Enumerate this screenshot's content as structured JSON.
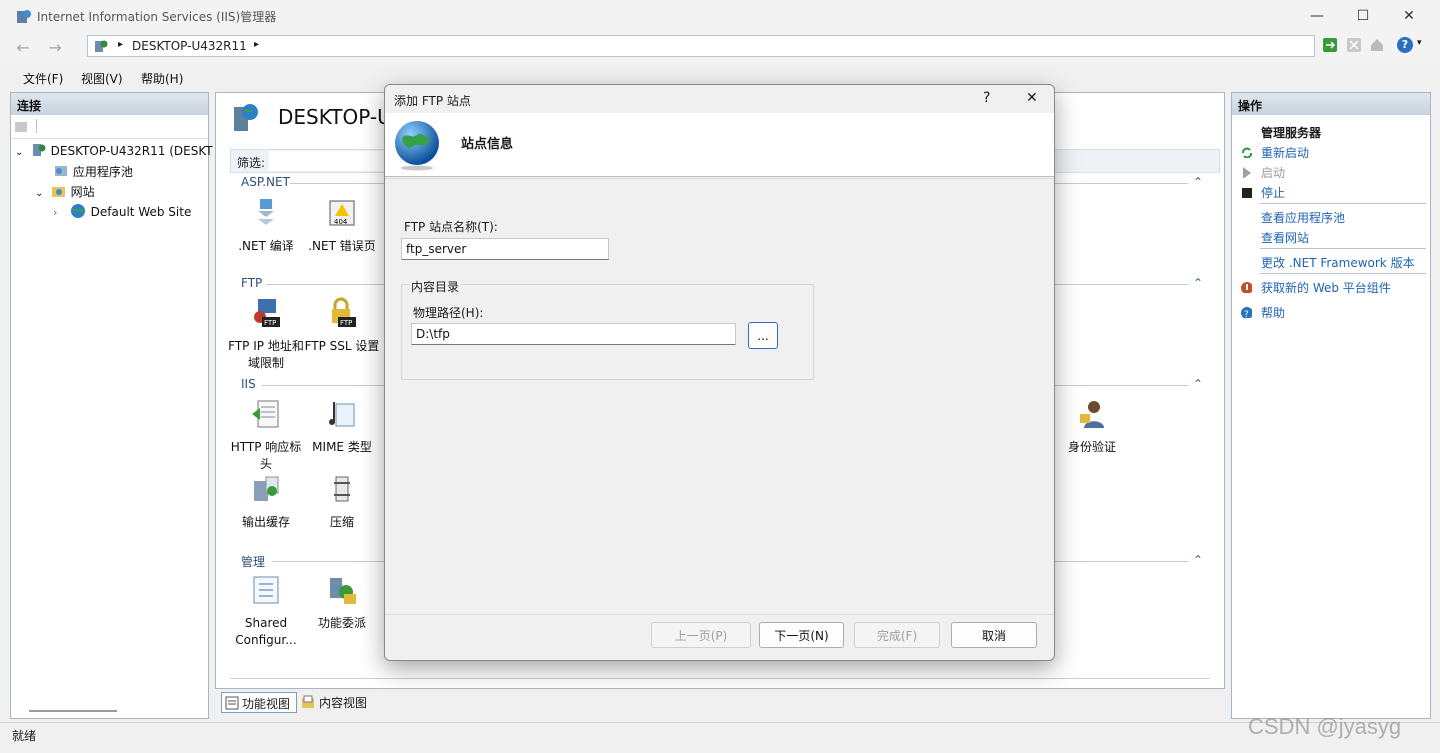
{
  "window": {
    "title": "Internet Information Services (IIS)管理器",
    "controls": {
      "minimize": "—",
      "maximize": "☐",
      "close": "✕"
    }
  },
  "address": {
    "crumb": "DESKTOP-U432R11",
    "sep": "▸",
    "back": "←",
    "forward": "→",
    "help": "?"
  },
  "menu": [
    "文件(F)",
    "视图(V)",
    "帮助(H)"
  ],
  "connections": {
    "title": "连接",
    "tree": [
      {
        "label": "DESKTOP-U432R11 (DESKT",
        "expander": "⌄"
      },
      {
        "label": "应用程序池",
        "expander": ""
      },
      {
        "label": "网站",
        "expander": "⌄"
      },
      {
        "label": "Default Web Site",
        "expander": "›"
      }
    ]
  },
  "center": {
    "title": "DESKTOP-U",
    "filter_label": "筛选:",
    "groups": [
      {
        "label": "ASP.NET",
        "features": [
          {
            "label": ".NET 编译"
          },
          {
            "label": ".NET 错误页"
          }
        ]
      },
      {
        "label": "FTP",
        "features": [
          {
            "label": "FTP IP 地址和域限制"
          },
          {
            "label": "FTP SSL 设置"
          }
        ]
      },
      {
        "label": "IIS",
        "features": [
          {
            "label": "HTTP 响应标头"
          },
          {
            "label": "MIME 类型"
          },
          {
            "label": "输出缓存"
          },
          {
            "label": "压缩"
          },
          {
            "label": "身份验证"
          }
        ]
      },
      {
        "label": "管理",
        "features": [
          {
            "label": "Shared Configur..."
          },
          {
            "label": "功能委派"
          }
        ]
      }
    ],
    "collapse_glyph": "⌃"
  },
  "actions": {
    "title": "操作",
    "section": "管理服务器",
    "items": [
      {
        "label": "重新启动",
        "disabled": false
      },
      {
        "label": "启动",
        "disabled": true
      },
      {
        "label": "停止",
        "disabled": false
      },
      {
        "label": "查看应用程序池",
        "disabled": false
      },
      {
        "label": "查看网站",
        "disabled": false
      },
      {
        "label": "更改 .NET Framework 版本",
        "disabled": false
      },
      {
        "label": "获取新的 Web 平台组件",
        "disabled": false
      },
      {
        "label": "帮助",
        "disabled": false
      }
    ]
  },
  "bottom_tabs": [
    "功能视图",
    "内容视图"
  ],
  "status": "就绪",
  "watermark": "CSDN @jyasyg",
  "dialog": {
    "title": "添加 FTP 站点",
    "help": "?",
    "close": "✕",
    "heading": "站点信息",
    "site_name_label": "FTP 站点名称(T):",
    "site_name_value": "ftp_server",
    "content_group": "内容目录",
    "path_label": "物理路径(H):",
    "path_value": "D:\\tfp",
    "browse_label": "...",
    "buttons": {
      "prev": "上一页(P)",
      "next": "下一页(N)",
      "finish": "完成(F)",
      "cancel": "取消"
    }
  }
}
